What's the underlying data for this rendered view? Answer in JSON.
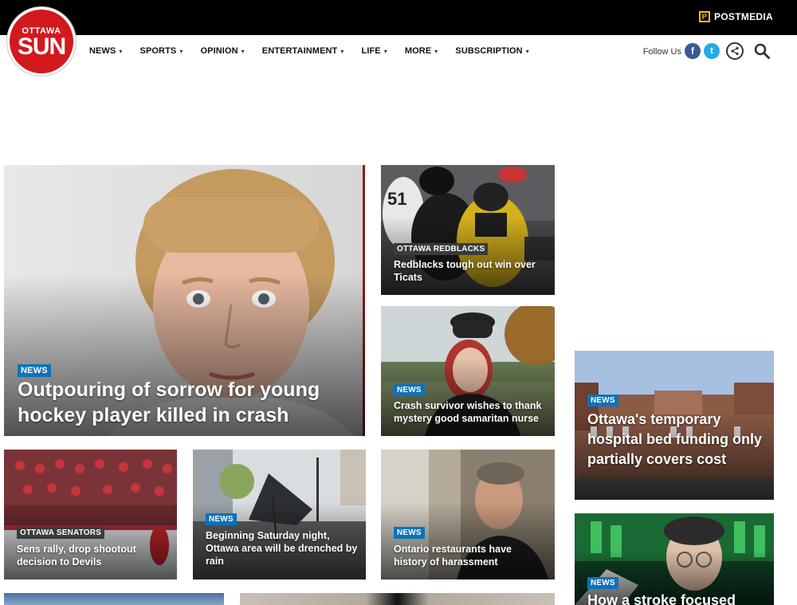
{
  "brand": {
    "logo_top": "OTTAWA",
    "logo_main": "SUN",
    "network": "POSTMEDIA",
    "network_mark": "P"
  },
  "nav": {
    "items": [
      "NEWS",
      "SPORTS",
      "OPINION",
      "ENTERTAINMENT",
      "LIFE",
      "MORE",
      "SUBSCRIPTION"
    ],
    "follow_label": "Follow Us",
    "facebook_glyph": "f",
    "twitter_glyph": "t",
    "share_glyph": "⋖"
  },
  "stories": [
    {
      "tag": "NEWS",
      "headline": "Outpouring of sorrow for young hockey player killed in crash"
    },
    {
      "tag": "OTTAWA REDBLACKS",
      "headline": "Redblacks tough out win over Ticats"
    },
    {
      "tag": "NEWS",
      "headline": "Crash survivor wishes to thank mystery good samaritan nurse"
    },
    {
      "tag": "NEWS",
      "headline": "Ottawa's temporary hospital bed funding only partially covers cost"
    },
    {
      "tag": "OTTAWA SENATORS",
      "headline": "Sens rally, drop shootout decision to Devils"
    },
    {
      "tag": "NEWS",
      "headline": "Beginning Saturday night, Ottawa area will be drenched by rain"
    },
    {
      "tag": "NEWS",
      "headline": "Ontario restaurants have history of harassment"
    },
    {
      "tag": "NEWS",
      "headline": "How a stroke focused"
    }
  ],
  "colors": {
    "brand_red": "#d3181e",
    "tag_blue": "#0e72b8",
    "topbar": "#000000"
  }
}
